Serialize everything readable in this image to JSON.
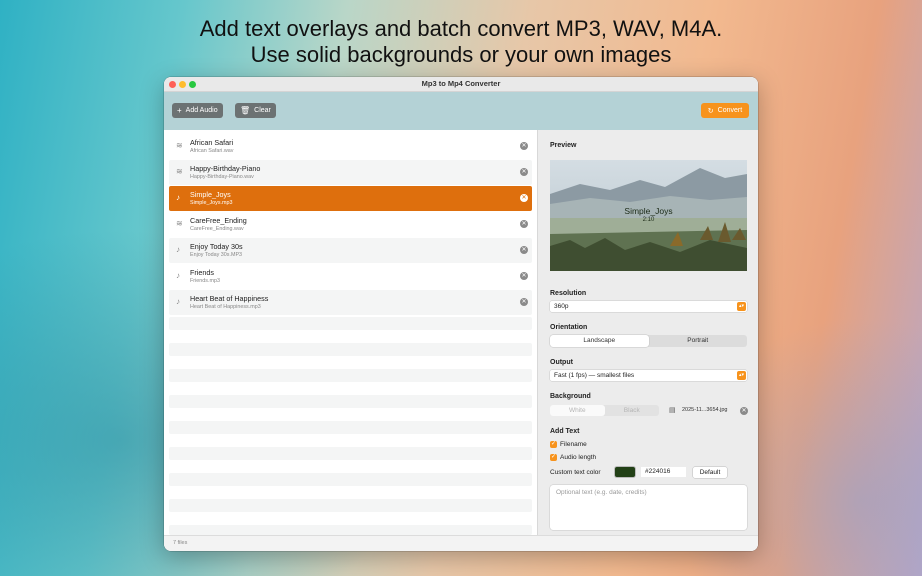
{
  "headline": {
    "line1": "Add text overlays and batch convert MP3, WAV, M4A.",
    "line2": "Use solid backgrounds or your own images"
  },
  "window": {
    "title": "Mp3 to Mp4 Converter"
  },
  "toolbar": {
    "add_audio_label": "Add Audio",
    "add_audio_icon": "plus-icon",
    "clear_label": "Clear",
    "clear_icon": "trash-icon",
    "convert_label": "Convert",
    "convert_icon": "refresh-icon",
    "accent_color": "#f7931d"
  },
  "files": [
    {
      "name": "African Safari",
      "filename": "African Safari.wav",
      "icon": "waveform-icon"
    },
    {
      "name": "Happy-Birthday-Piano",
      "filename": "Happy-Birthday-Piano.wav",
      "icon": "waveform-icon"
    },
    {
      "name": "Simple_Joys",
      "filename": "Simple_Joys.mp3",
      "icon": "music-note-icon",
      "selected": true
    },
    {
      "name": "CareFree_Ending",
      "filename": "CareFree_Ending.wav",
      "icon": "waveform-icon"
    },
    {
      "name": "Enjoy Today 30s",
      "filename": "Enjoy Today 30s.MP3",
      "icon": "music-note-icon"
    },
    {
      "name": "Friends",
      "filename": "Friends.mp3",
      "icon": "music-note-icon"
    },
    {
      "name": "Heart Beat of Happiness",
      "filename": "Heart Beat of Happiness.mp3",
      "icon": "music-note-icon"
    }
  ],
  "selection_color": "#de6f0d",
  "status": {
    "count_label": "7 files"
  },
  "settings": {
    "preview": {
      "label": "Preview",
      "title": "Simple_Joys",
      "length": "2:10"
    },
    "resolution": {
      "label": "Resolution",
      "value": "360p"
    },
    "orientation": {
      "label": "Orientation",
      "options": [
        "Landscape",
        "Portrait"
      ],
      "selected": "Landscape"
    },
    "output": {
      "label": "Output",
      "value": "Fast (1 fps) — smallest files"
    },
    "background": {
      "label": "Background",
      "options": [
        "White",
        "Black"
      ],
      "image_file": "2025-11...3654.jpg"
    },
    "add_text": {
      "label": "Add Text",
      "filename_label": "Filename",
      "filename_checked": true,
      "audio_length_label": "Audio length",
      "audio_length_checked": true,
      "custom_color_label": "Custom text color",
      "color_value": "#224016",
      "default_label": "Default",
      "placeholder": "Optional text (e.g. date, credits)"
    }
  }
}
